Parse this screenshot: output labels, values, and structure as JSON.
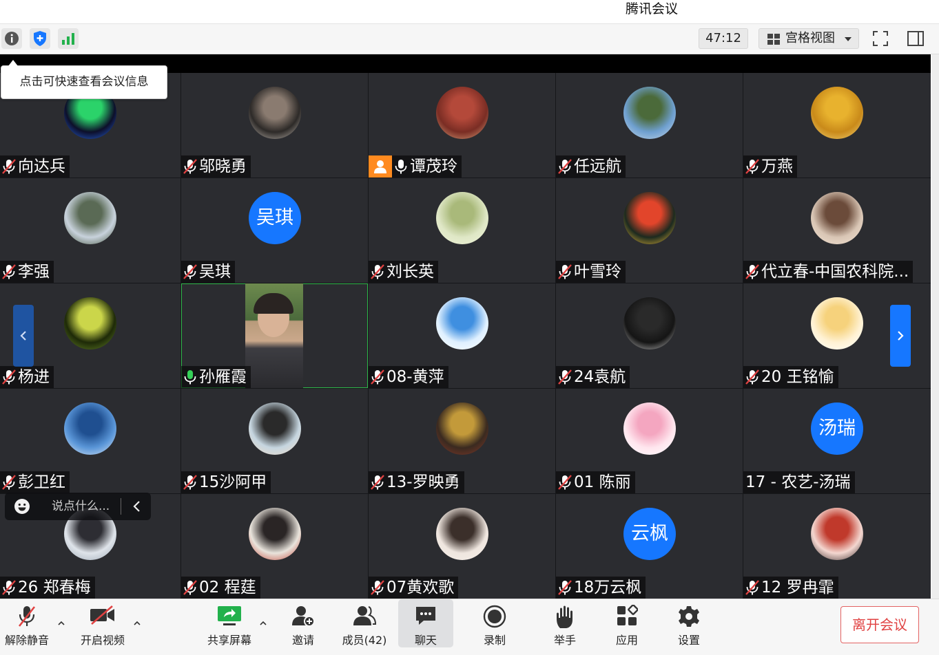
{
  "window": {
    "title": "腾讯会议"
  },
  "topbar": {
    "timer": "47:12",
    "view_mode": "宫格视图"
  },
  "tooltip": "点击可快速查看会议信息",
  "chat": {
    "placeholder": "说点什么..."
  },
  "tiles": [
    {
      "name": "向达兵",
      "muted": true,
      "avatar": "photo"
    },
    {
      "name": "邬晓勇",
      "muted": true,
      "avatar": "photo"
    },
    {
      "name": "谭茂玲",
      "muted": false,
      "host": true,
      "avatar": "photo"
    },
    {
      "name": "任远航",
      "muted": true,
      "avatar": "photo"
    },
    {
      "name": "万燕",
      "muted": true,
      "avatar": "photo"
    },
    {
      "name": "李强",
      "muted": true,
      "avatar": "photo"
    },
    {
      "name": "吴琪",
      "muted": true,
      "avatar": "text",
      "avatar_text": "吴琪"
    },
    {
      "name": "刘长英",
      "muted": true,
      "avatar": "photo"
    },
    {
      "name": "叶雪玲",
      "muted": true,
      "avatar": "photo"
    },
    {
      "name": "代立春-中国农科院...",
      "muted": true,
      "avatar": "photo"
    },
    {
      "name": "杨进",
      "muted": true,
      "avatar": "photo"
    },
    {
      "name": "孙雁霞",
      "muted": false,
      "speaking": true,
      "avatar": "video"
    },
    {
      "name": "08-黄萍",
      "muted": true,
      "avatar": "photo"
    },
    {
      "name": "24袁航",
      "muted": true,
      "avatar": "photo"
    },
    {
      "name": "20 王铭愉",
      "muted": true,
      "avatar": "photo"
    },
    {
      "name": "彭卫红",
      "muted": true,
      "avatar": "photo"
    },
    {
      "name": "15沙阿甲",
      "muted": true,
      "avatar": "photo"
    },
    {
      "name": "13-罗映勇",
      "muted": true,
      "avatar": "photo"
    },
    {
      "name": "01 陈丽",
      "muted": true,
      "avatar": "photo"
    },
    {
      "name": "17 - 农艺-汤瑞",
      "muted": null,
      "avatar": "text",
      "avatar_text": "汤瑞"
    },
    {
      "name": "26 郑春梅",
      "muted": true,
      "avatar": "photo"
    },
    {
      "name": "02 程莛",
      "muted": true,
      "avatar": "photo"
    },
    {
      "name": "07黄欢歌",
      "muted": true,
      "avatar": "photo"
    },
    {
      "name": "18万云枫",
      "muted": true,
      "avatar": "text",
      "avatar_text": "云枫"
    },
    {
      "name": "12 罗冉霏",
      "muted": true,
      "avatar": "photo"
    }
  ],
  "toolbar": {
    "unmute": "解除静音",
    "start_video": "开启视频",
    "share_screen": "共享屏幕",
    "invite": "邀请",
    "members": "成员(42)",
    "chat": "聊天",
    "record": "录制",
    "raise_hand": "举手",
    "apps": "应用",
    "settings": "设置",
    "leave": "离开会议"
  },
  "colors": {
    "accent": "#1677ff",
    "host_badge": "#ff8a1f",
    "speaking": "#2fb84a",
    "leave": "#e04242"
  }
}
